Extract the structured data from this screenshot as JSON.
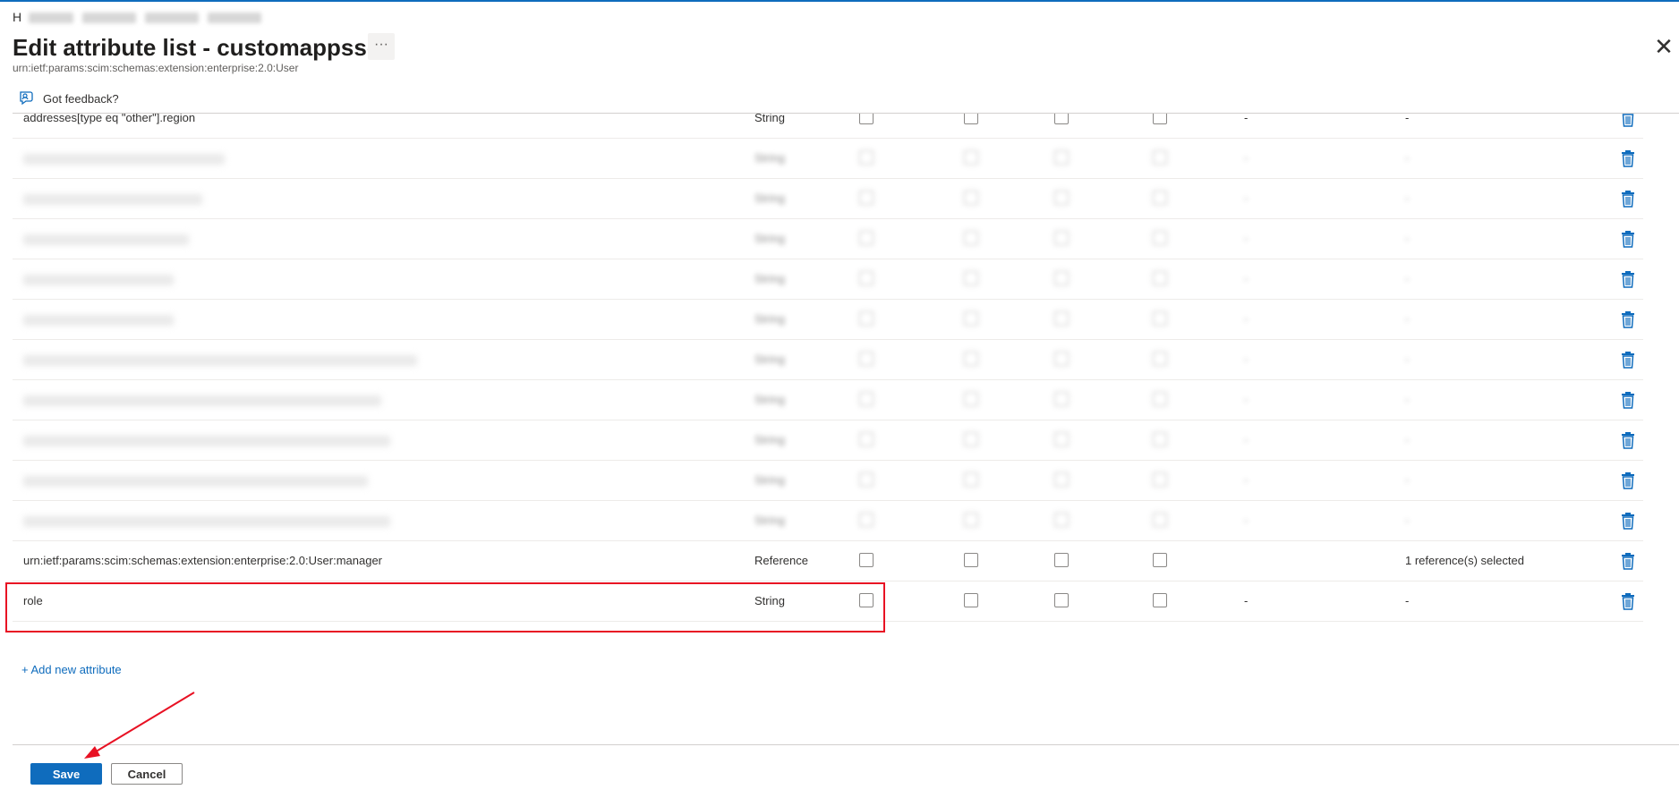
{
  "breadcrumb": {
    "first": "H"
  },
  "header": {
    "title": "Edit attribute list - customappsso",
    "subtitle": "urn:ietf:params:scim:schemas:extension:enterprise:2.0:User",
    "more_label": "···",
    "close_label": "✕"
  },
  "feedback": {
    "label": "Got feedback?"
  },
  "rows": [
    {
      "name": "addresses[type eq \"other\"].region",
      "type": "String",
      "col5": "-",
      "col6": "-"
    },
    {
      "name": "",
      "type": "String",
      "col5": "-",
      "col6": "-"
    },
    {
      "name": "",
      "type": "String",
      "col5": "-",
      "col6": "-"
    },
    {
      "name": "",
      "type": "String",
      "col5": "-",
      "col6": "-"
    },
    {
      "name": "",
      "type": "String",
      "col5": "-",
      "col6": "-"
    },
    {
      "name": "",
      "type": "String",
      "col5": "-",
      "col6": "-"
    },
    {
      "name": "",
      "type": "String",
      "col5": "-",
      "col6": "-"
    },
    {
      "name": "",
      "type": "String",
      "col5": "-",
      "col6": "-"
    },
    {
      "name": "",
      "type": "String",
      "col5": "-",
      "col6": "-"
    },
    {
      "name": "",
      "type": "String",
      "col5": "-",
      "col6": "-"
    },
    {
      "name": "",
      "type": "String",
      "col5": "-",
      "col6": "-"
    },
    {
      "name": "urn:ietf:params:scim:schemas:extension:enterprise:2.0:User:manager",
      "type": "Reference",
      "col5": "",
      "col6": "1 reference(s) selected"
    },
    {
      "name": "role",
      "type": "String",
      "col5": "-",
      "col6": "-"
    }
  ],
  "add_link": "+ Add new attribute",
  "footer": {
    "save_label": "Save",
    "cancel_label": "Cancel"
  },
  "colors": {
    "accent": "#0f6cbd",
    "highlight": "#e81123"
  }
}
